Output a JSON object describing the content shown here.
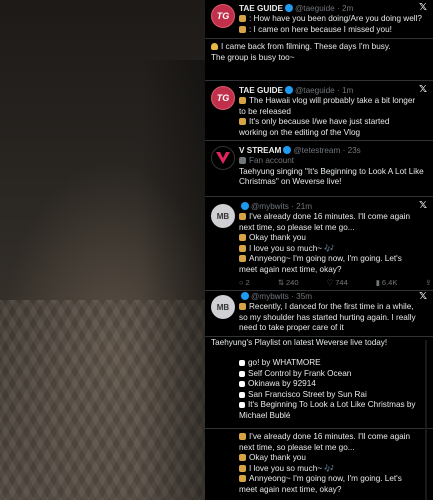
{
  "photo": {
    "description_icon": "portrait-photo"
  },
  "posts": [
    {
      "author": "TAE GUIDE",
      "handle": "@taeguide · 2m",
      "avatar_text": "TG",
      "lines": [
        ": How have you been doing/Are you doing well?",
        ": I came on here because I missed you!"
      ]
    },
    {
      "lines": [
        "I came back from filming. These days I'm busy.",
        "The group is busy too~"
      ]
    },
    {
      "author": "TAE GUIDE",
      "handle": "@taeguide · 1m",
      "avatar_text": "TG",
      "lines": [
        "The Hawaii vlog will probably take a bit longer",
        "to be released",
        "It's only because I/we have just started",
        "working on the editing of the Vlog"
      ]
    },
    {
      "author": "V STREAM",
      "handle": "@tetestream · 23s",
      "avatar_text": "V",
      "lines": [
        "Fan account",
        "Taehyung singing \"It's Beginning to Look A Lot Like",
        "Christmas\" on Weverse live!"
      ]
    },
    {
      "handle": "@mybwits · 21m",
      "avatar_text": "MB",
      "lines": [
        "I've already done 16 minutes. I'll come again",
        "next time, so please let me go...",
        "Okay thank you",
        "I love you so much~ 🎶",
        "Annyeong~ I'm going now, I'm going. Let's",
        "meet again next time, okay?"
      ],
      "actions": {
        "replies": "2",
        "retweets": "240",
        "likes": "744",
        "views": "6.4K"
      }
    },
    {
      "handle": "@mybwits · 35m",
      "avatar_text": "MB",
      "lines": [
        "Recently, I danced for the first time in a while,",
        "so my shoulder has started hurting again. I really",
        "need to take proper care of it"
      ]
    },
    {
      "title": "Taehyung's Playlist on latest Weverse live today!",
      "lines": [
        "go! by WHATMORE",
        "Self Control by Frank Ocean",
        "Okinawa by 92914",
        "San Francisco Street by Sun Rai",
        "It's Beginning To Look a Lot Like Christmas by",
        "Michael Bublé"
      ]
    },
    {
      "lines": [
        "I've already done 16 minutes. I'll come again",
        "next time, so please let me go...",
        "Okay thank you",
        "I love you so much~ 🎶",
        "Annyeong~ I'm going now, I'm going. Let's",
        "meet again next time, okay?"
      ]
    }
  ],
  "colors": {
    "accent": "#1d9bf0",
    "tg_avatar": "#c0304a"
  }
}
